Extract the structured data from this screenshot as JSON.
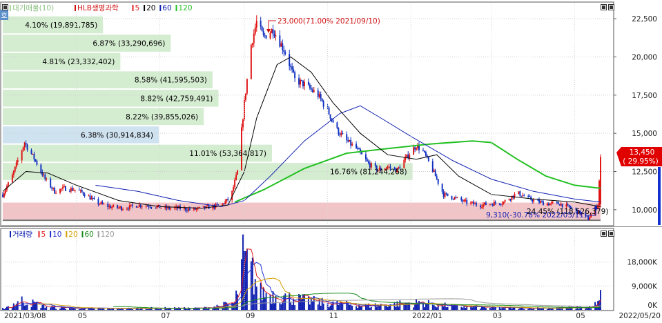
{
  "legend_top": {
    "items": [
      {
        "text": "대기매물(10)",
        "color": "#a6d99b"
      },
      {
        "text": "HLB생명과학",
        "color": "#d01010"
      },
      {
        "text": "5",
        "color": "#e02020"
      },
      {
        "text": "20",
        "color": "#000000"
      },
      {
        "text": "60",
        "color": "#1020b0"
      },
      {
        "text": "120",
        "color": "#22c022"
      }
    ]
  },
  "legend_bottom": {
    "items": [
      {
        "text": "거래량",
        "color": "#1020b0"
      },
      {
        "text": "5",
        "color": "#e02020"
      },
      {
        "text": "10",
        "color": "#2030d0"
      },
      {
        "text": "20",
        "color": "#d4a000"
      },
      {
        "text": "60",
        "color": "#1a8a1a"
      },
      {
        "text": "120",
        "color": "#999999"
      }
    ]
  },
  "side_tab": "호",
  "last_price": {
    "value": "13,450",
    "change": "( 29.95%)"
  },
  "annotations": {
    "high": "23,000(71.00% 2021/09/10)",
    "low": "9,310(-30.78% 2022/05/11)"
  },
  "chart_data": [
    {
      "type": "candlestick",
      "ylim": [
        9000,
        23500
      ],
      "y_ticks": [
        10000,
        12500,
        15000,
        17500,
        20000,
        22500
      ],
      "y_tick_labels": [
        "10,000",
        "12,500",
        "15,000",
        "17,500",
        "20,000",
        "22,500"
      ],
      "x_labels": [
        "2021/03/08",
        "05",
        "07",
        "09",
        "11",
        "2022/01",
        "03",
        "05",
        "2022/05/20"
      ],
      "x_label_dates": [
        "2021-03-08",
        "2021-05-01",
        "2021-07-01",
        "2021-09-01",
        "2021-11-01",
        "2022-01-01",
        "2022-03-01",
        "2022-05-01",
        "2022-05-20"
      ],
      "date_range": [
        "2021-03-08",
        "2022-05-20"
      ],
      "price_path": [
        [
          "2021-03-08",
          11000
        ],
        [
          "2021-03-15",
          12200
        ],
        [
          "2021-03-19",
          13200
        ],
        [
          "2021-03-24",
          14400
        ],
        [
          "2021-04-01",
          13200
        ],
        [
          "2021-04-08",
          12000
        ],
        [
          "2021-04-15",
          11200
        ],
        [
          "2021-04-22",
          11400
        ],
        [
          "2021-05-01",
          11300
        ],
        [
          "2021-05-08",
          11000
        ],
        [
          "2021-05-15",
          10500
        ],
        [
          "2021-05-25",
          10200
        ],
        [
          "2021-06-05",
          10100
        ],
        [
          "2021-06-15",
          10300
        ],
        [
          "2021-06-25",
          10250
        ],
        [
          "2021-07-05",
          10100
        ],
        [
          "2021-07-15",
          10100
        ],
        [
          "2021-07-25",
          10000
        ],
        [
          "2021-08-05",
          10150
        ],
        [
          "2021-08-15",
          10300
        ],
        [
          "2021-08-22",
          10800
        ],
        [
          "2021-08-27",
          12500
        ],
        [
          "2021-09-01",
          17000
        ],
        [
          "2021-09-06",
          20800
        ],
        [
          "2021-09-10",
          22300
        ],
        [
          "2021-09-15",
          21300
        ],
        [
          "2021-09-22",
          21800
        ],
        [
          "2021-10-01",
          20300
        ],
        [
          "2021-10-08",
          18500
        ],
        [
          "2021-10-15",
          18200
        ],
        [
          "2021-10-25",
          17500
        ],
        [
          "2021-11-01",
          16500
        ],
        [
          "2021-11-08",
          15200
        ],
        [
          "2021-11-15",
          14500
        ],
        [
          "2021-11-22",
          14000
        ],
        [
          "2021-12-01",
          13000
        ],
        [
          "2021-12-08",
          12600
        ],
        [
          "2021-12-15",
          12800
        ],
        [
          "2021-12-22",
          12600
        ],
        [
          "2022-01-01",
          13800
        ],
        [
          "2022-01-05",
          14200
        ],
        [
          "2022-01-10",
          13800
        ],
        [
          "2022-01-17",
          12600
        ],
        [
          "2022-01-25",
          11000
        ],
        [
          "2022-02-01",
          10800
        ],
        [
          "2022-02-10",
          10500
        ],
        [
          "2022-02-20",
          10300
        ],
        [
          "2022-03-01",
          10400
        ],
        [
          "2022-03-10",
          10500
        ],
        [
          "2022-03-20",
          11100
        ],
        [
          "2022-04-01",
          10600
        ],
        [
          "2022-04-10",
          10400
        ],
        [
          "2022-04-20",
          10400
        ],
        [
          "2022-05-01",
          10000
        ],
        [
          "2022-05-11",
          9400
        ],
        [
          "2022-05-18",
          10350
        ],
        [
          "2022-05-20",
          13450
        ]
      ],
      "overlays": {
        "ma20": [
          [
            "2021-03-08",
            11200
          ],
          [
            "2021-03-25",
            12500
          ],
          [
            "2021-04-10",
            12400
          ],
          [
            "2021-05-01",
            11600
          ],
          [
            "2021-06-01",
            10600
          ],
          [
            "2021-07-01",
            10200
          ],
          [
            "2021-08-01",
            10100
          ],
          [
            "2021-08-20",
            10300
          ],
          [
            "2021-09-01",
            12500
          ],
          [
            "2021-09-10",
            16000
          ],
          [
            "2021-09-25",
            19500
          ],
          [
            "2021-10-05",
            20000
          ],
          [
            "2021-10-20",
            19000
          ],
          [
            "2021-11-05",
            17000
          ],
          [
            "2021-11-25",
            15000
          ],
          [
            "2021-12-15",
            13600
          ],
          [
            "2022-01-05",
            13300
          ],
          [
            "2022-01-20",
            13600
          ],
          [
            "2022-02-05",
            12200
          ],
          [
            "2022-03-01",
            11000
          ],
          [
            "2022-04-01",
            10700
          ],
          [
            "2022-05-01",
            10500
          ],
          [
            "2022-05-20",
            10200
          ]
        ],
        "ma60": [
          [
            "2021-05-15",
            11600
          ],
          [
            "2021-06-15",
            11200
          ],
          [
            "2021-07-15",
            10600
          ],
          [
            "2021-08-15",
            10200
          ],
          [
            "2021-09-01",
            10600
          ],
          [
            "2021-09-20",
            12200
          ],
          [
            "2021-10-15",
            14500
          ],
          [
            "2021-11-10",
            16300
          ],
          [
            "2021-11-25",
            16800
          ],
          [
            "2021-12-10",
            16000
          ],
          [
            "2022-01-01",
            14800
          ],
          [
            "2022-02-01",
            13200
          ],
          [
            "2022-03-01",
            12000
          ],
          [
            "2022-04-01",
            11200
          ],
          [
            "2022-05-01",
            10700
          ],
          [
            "2022-05-20",
            10500
          ]
        ],
        "ma120": [
          [
            "2021-08-25",
            10500
          ],
          [
            "2021-09-15",
            11300
          ],
          [
            "2021-10-15",
            12700
          ],
          [
            "2021-11-15",
            13700
          ],
          [
            "2021-12-15",
            14000
          ],
          [
            "2022-01-15",
            14300
          ],
          [
            "2022-02-15",
            14500
          ],
          [
            "2022-03-01",
            14400
          ],
          [
            "2022-03-20",
            13300
          ],
          [
            "2022-04-10",
            12200
          ],
          [
            "2022-05-01",
            11600
          ],
          [
            "2022-05-20",
            11400
          ]
        ]
      },
      "volume_profile": [
        {
          "label": "4.10% (19,891,785)",
          "lo": 21500,
          "hi": 22700,
          "pct": 4.1
        },
        {
          "label": "6.87% (33,290,696)",
          "lo": 20300,
          "hi": 21500,
          "pct": 6.87
        },
        {
          "label": "4.81% (23,332,402)",
          "lo": 19100,
          "hi": 20300,
          "pct": 4.81
        },
        {
          "label": "8.58% (41,595,503)",
          "lo": 17900,
          "hi": 19100,
          "pct": 8.58
        },
        {
          "label": "8.82% (42,759,491)",
          "lo": 16700,
          "hi": 17900,
          "pct": 8.82
        },
        {
          "label": "8.22% (39,855,026)",
          "lo": 15500,
          "hi": 16700,
          "pct": 8.22
        },
        {
          "label": "6.38% (30,914,834)",
          "lo": 14300,
          "hi": 15500,
          "pct": 6.38,
          "highlight": "current"
        },
        {
          "label": "11.01% (53,364,817)",
          "lo": 13100,
          "hi": 14300,
          "pct": 11.01
        },
        {
          "label": "16.76% (81,244,268)",
          "lo": 11900,
          "hi": 13100,
          "pct": 16.76
        },
        {
          "label": "24.45% (118,526,379)",
          "lo": 9310,
          "hi": 10510,
          "pct": 24.45,
          "highlight": "max"
        }
      ]
    },
    {
      "type": "bar",
      "title": "거래량",
      "ylim": [
        0,
        27000
      ],
      "y_ticks": [
        0,
        9000,
        18000
      ],
      "y_tick_labels": [
        "0K",
        "9,000K",
        "18,000K"
      ],
      "volume_path": [
        [
          "2021-03-08",
          500
        ],
        [
          "2021-03-22",
          3500
        ],
        [
          "2021-04-10",
          1200
        ],
        [
          "2021-05-01",
          600
        ],
        [
          "2021-06-01",
          500
        ],
        [
          "2021-07-01",
          700
        ],
        [
          "2021-08-01",
          600
        ],
        [
          "2021-08-25",
          2500
        ],
        [
          "2021-08-31",
          18000
        ],
        [
          "2021-09-06",
          14500
        ],
        [
          "2021-09-13",
          6500
        ],
        [
          "2021-09-25",
          5500
        ],
        [
          "2021-10-10",
          4000
        ],
        [
          "2021-11-01",
          2500
        ],
        [
          "2021-12-01",
          1600
        ],
        [
          "2022-01-05",
          2700
        ],
        [
          "2022-02-01",
          1400
        ],
        [
          "2022-03-01",
          900
        ],
        [
          "2022-04-01",
          700
        ],
        [
          "2022-05-11",
          900
        ],
        [
          "2022-05-19",
          2600
        ],
        [
          "2022-05-20",
          7500
        ]
      ]
    }
  ]
}
